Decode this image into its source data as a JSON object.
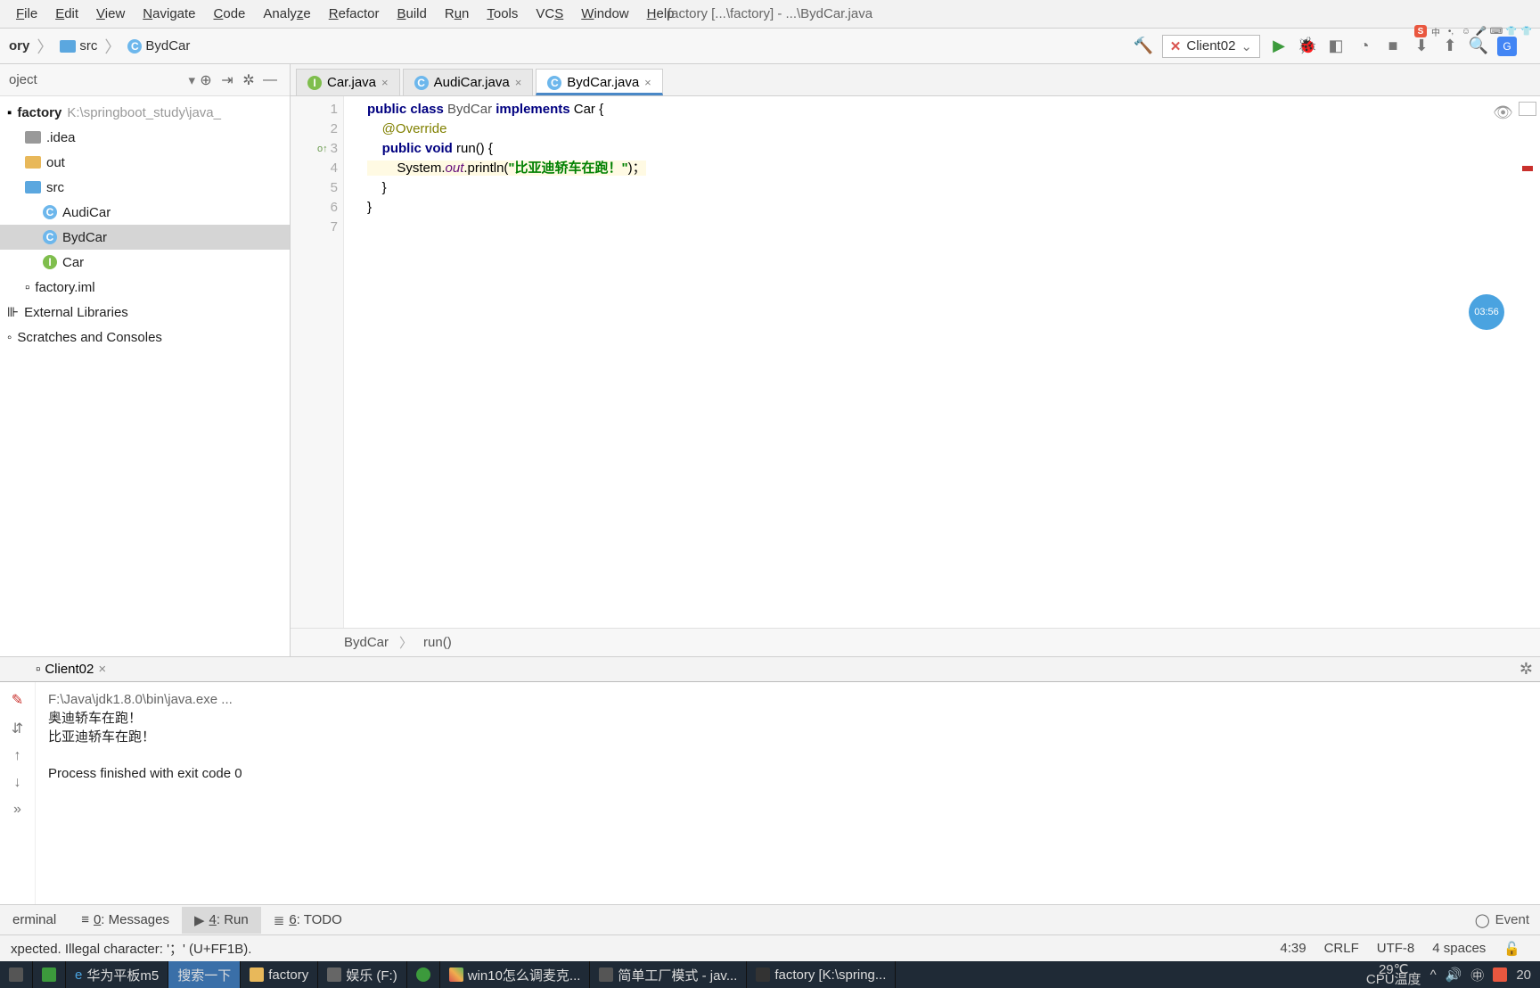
{
  "menu": [
    "File",
    "Edit",
    "View",
    "Navigate",
    "Code",
    "Analyze",
    "Refactor",
    "Build",
    "Run",
    "Tools",
    "VCS",
    "Window",
    "Help"
  ],
  "window_title": "factory [...\\factory] - ...\\BydCar.java",
  "breadcrumb": {
    "root": "ory",
    "folder": "src",
    "file": "BydCar"
  },
  "run_config": "Client02",
  "sidebar": {
    "title": "oject",
    "project_name": "factory",
    "project_path": "K:\\springboot_study\\java_",
    "items": [
      {
        "icon": "folder-g",
        "name": ".idea",
        "indent": 1
      },
      {
        "icon": "folder-y",
        "name": "out",
        "indent": 1
      },
      {
        "icon": "folder",
        "name": "src",
        "indent": 1
      },
      {
        "icon": "c",
        "name": "AudiCar",
        "indent": 2
      },
      {
        "icon": "c",
        "name": "BydCar",
        "indent": 2,
        "selected": true
      },
      {
        "icon": "i",
        "name": "Car",
        "indent": 2
      },
      {
        "icon": "file",
        "name": "factory.iml",
        "indent": 1
      }
    ],
    "extra": [
      "External Libraries",
      "Scratches and Consoles"
    ]
  },
  "tabs": [
    {
      "icon": "i",
      "name": "Car.java"
    },
    {
      "icon": "c",
      "name": "AudiCar.java"
    },
    {
      "icon": "c",
      "name": "BydCar.java",
      "active": true
    }
  ],
  "code": {
    "lines": 7,
    "l1_a": "public class",
    "l1_b": " BydCar ",
    "l1_c": "implements",
    "l1_d": " Car {",
    "l2": "    @Override",
    "l3_a": "    public void",
    "l3_b": " run() {",
    "l4_a": "        System.",
    "l4_b": "out",
    "l4_c": ".println(",
    "l4_d": "\"比亚迪轿车在跑！\"",
    "l4_e": ")；",
    "l5": "    }",
    "l6": "}"
  },
  "editor_crumb": {
    "a": "BydCar",
    "b": "run()"
  },
  "run_tab": "Client02",
  "console": {
    "cmd": "F:\\Java\\jdk1.8.0\\bin\\java.exe ...",
    "out1": "奥迪轿车在跑！",
    "out2": "比亚迪轿车在跑！",
    "exit": "Process finished with exit code 0"
  },
  "bottom_tabs": {
    "terminal": "erminal",
    "messages": "0: Messages",
    "run": "4: Run",
    "todo": "6: TODO",
    "event": "Event"
  },
  "status": {
    "msg": "xpected. Illegal character: '；'  (U+FF1B).",
    "pos": "4:39",
    "eol": "CRLF",
    "enc": "UTF-8",
    "indent": "4 spaces"
  },
  "taskbar": {
    "items": [
      "华为平板m5",
      "搜索一下",
      "factory",
      "娱乐 (F:)",
      "",
      "win10怎么调麦克...",
      "简单工厂模式 - jav...",
      "factory [K:\\spring..."
    ],
    "temp": "29℃",
    "cpu": "CPU温度",
    "clock": "20"
  },
  "floating": "03:56"
}
